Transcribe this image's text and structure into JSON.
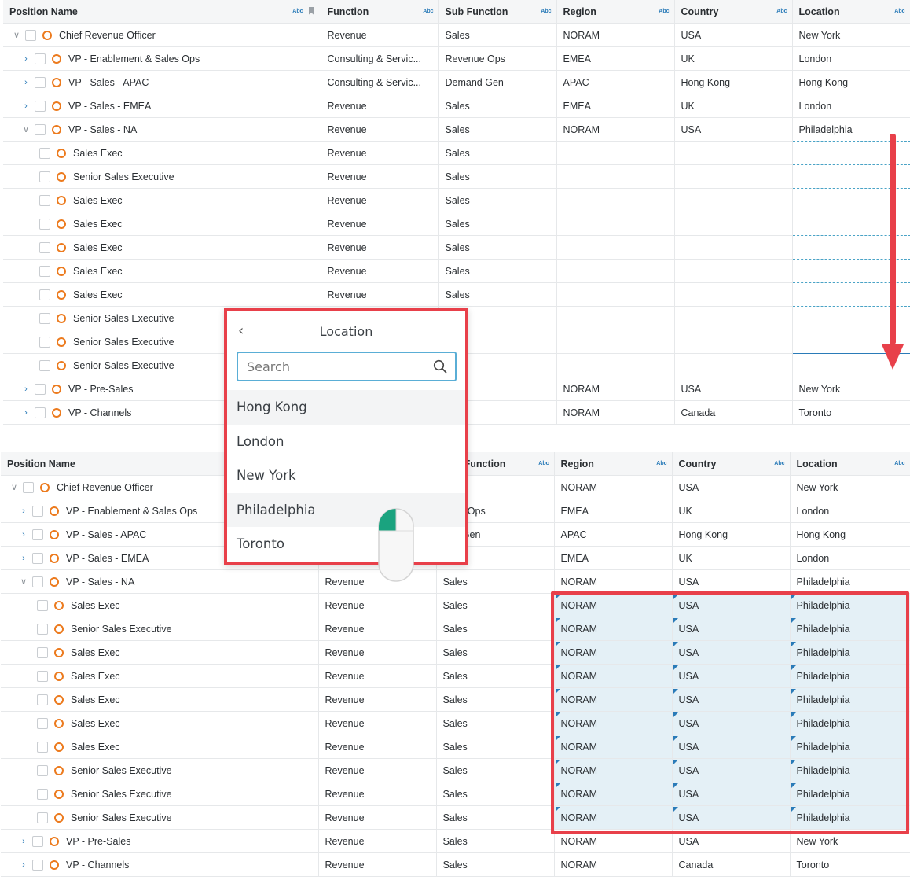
{
  "columns": [
    "Position Name",
    "Function",
    "Sub Function",
    "Region",
    "Country",
    "Location"
  ],
  "column_type_badge": "Abc",
  "top_grid": {
    "rows": [
      {
        "name": "Chief Revenue Officer",
        "level": 0,
        "expand": "open",
        "function": "Revenue",
        "sub": "Sales",
        "region": "NORAM",
        "country": "USA",
        "location": "New York"
      },
      {
        "name": "VP - Enablement & Sales Ops",
        "level": 1,
        "expand": "closed",
        "function": "Consulting & Servic...",
        "sub": "Revenue Ops",
        "region": "EMEA",
        "country": "UK",
        "location": "London"
      },
      {
        "name": "VP - Sales - APAC",
        "level": 1,
        "expand": "closed",
        "function": "Consulting & Servic...",
        "sub": "Demand Gen",
        "region": "APAC",
        "country": "Hong Kong",
        "location": "Hong Kong"
      },
      {
        "name": "VP - Sales - EMEA",
        "level": 1,
        "expand": "closed",
        "function": "Revenue",
        "sub": "Sales",
        "region": "EMEA",
        "country": "UK",
        "location": "London"
      },
      {
        "name": "VP - Sales - NA",
        "level": 1,
        "expand": "open",
        "function": "Revenue",
        "sub": "Sales",
        "region": "NORAM",
        "country": "USA",
        "location": "Philadelphia"
      },
      {
        "name": "Sales Exec",
        "level": 2,
        "expand": "none",
        "function": "Revenue",
        "sub": "Sales",
        "region": "",
        "country": "",
        "location": ""
      },
      {
        "name": "Senior Sales Executive",
        "level": 2,
        "expand": "none",
        "function": "Revenue",
        "sub": "Sales",
        "region": "",
        "country": "",
        "location": ""
      },
      {
        "name": "Sales Exec",
        "level": 2,
        "expand": "none",
        "function": "Revenue",
        "sub": "Sales",
        "region": "",
        "country": "",
        "location": ""
      },
      {
        "name": "Sales Exec",
        "level": 2,
        "expand": "none",
        "function": "Revenue",
        "sub": "Sales",
        "region": "",
        "country": "",
        "location": ""
      },
      {
        "name": "Sales Exec",
        "level": 2,
        "expand": "none",
        "function": "Revenue",
        "sub": "Sales",
        "region": "",
        "country": "",
        "location": ""
      },
      {
        "name": "Sales Exec",
        "level": 2,
        "expand": "none",
        "function": "Revenue",
        "sub": "Sales",
        "region": "",
        "country": "",
        "location": ""
      },
      {
        "name": "Sales Exec",
        "level": 2,
        "expand": "none",
        "function": "Revenue",
        "sub": "Sales",
        "region": "",
        "country": "",
        "location": ""
      },
      {
        "name": "Senior Sales Executive",
        "level": 2,
        "expand": "none",
        "function": "Revenue",
        "sub": "s",
        "region": "",
        "country": "",
        "location": ""
      },
      {
        "name": "Senior Sales Executive",
        "level": 2,
        "expand": "none",
        "function": "",
        "sub": "s",
        "region": "",
        "country": "",
        "location": ""
      },
      {
        "name": "Senior Sales Executive",
        "level": 2,
        "expand": "none",
        "function": "",
        "sub": "s",
        "region": "",
        "country": "",
        "location": ""
      },
      {
        "name": "VP - Pre-Sales",
        "level": 1,
        "expand": "closed",
        "function": "",
        "sub": "s",
        "region": "NORAM",
        "country": "USA",
        "location": "New York"
      },
      {
        "name": "VP - Channels",
        "level": 1,
        "expand": "closed",
        "function": "",
        "sub": "s",
        "region": "NORAM",
        "country": "Canada",
        "location": "Toronto"
      }
    ]
  },
  "bottom_grid": {
    "header_partial": {
      "function": "unction"
    },
    "rows": [
      {
        "name": "Chief Revenue Officer",
        "level": 0,
        "expand": "open",
        "function": "",
        "sub": "s",
        "region": "NORAM",
        "country": "USA",
        "location": "New York"
      },
      {
        "name": "VP - Enablement & Sales Ops",
        "level": 1,
        "expand": "closed",
        "function": "",
        "sub": "enue Ops",
        "region": "EMEA",
        "country": "UK",
        "location": "London"
      },
      {
        "name": "VP - Sales - APAC",
        "level": 1,
        "expand": "closed",
        "function": "",
        "sub": "and Gen",
        "region": "APAC",
        "country": "Hong Kong",
        "location": "Hong Kong"
      },
      {
        "name": "VP - Sales - EMEA",
        "level": 1,
        "expand": "closed",
        "function": "",
        "sub": "s",
        "region": "EMEA",
        "country": "UK",
        "location": "London"
      },
      {
        "name": "VP - Sales - NA",
        "level": 1,
        "expand": "open",
        "function": "Revenue",
        "sub": "Sales",
        "region": "NORAM",
        "country": "USA",
        "location": "Philadelphia"
      },
      {
        "name": "Sales Exec",
        "level": 2,
        "expand": "none",
        "function": "Revenue",
        "sub": "Sales",
        "region": "NORAM",
        "country": "USA",
        "location": "Philadelphia",
        "hl": true
      },
      {
        "name": "Senior Sales Executive",
        "level": 2,
        "expand": "none",
        "function": "Revenue",
        "sub": "Sales",
        "region": "NORAM",
        "country": "USA",
        "location": "Philadelphia",
        "hl": true
      },
      {
        "name": "Sales Exec",
        "level": 2,
        "expand": "none",
        "function": "Revenue",
        "sub": "Sales",
        "region": "NORAM",
        "country": "USA",
        "location": "Philadelphia",
        "hl": true
      },
      {
        "name": "Sales Exec",
        "level": 2,
        "expand": "none",
        "function": "Revenue",
        "sub": "Sales",
        "region": "NORAM",
        "country": "USA",
        "location": "Philadelphia",
        "hl": true
      },
      {
        "name": "Sales Exec",
        "level": 2,
        "expand": "none",
        "function": "Revenue",
        "sub": "Sales",
        "region": "NORAM",
        "country": "USA",
        "location": "Philadelphia",
        "hl": true
      },
      {
        "name": "Sales Exec",
        "level": 2,
        "expand": "none",
        "function": "Revenue",
        "sub": "Sales",
        "region": "NORAM",
        "country": "USA",
        "location": "Philadelphia",
        "hl": true
      },
      {
        "name": "Sales Exec",
        "level": 2,
        "expand": "none",
        "function": "Revenue",
        "sub": "Sales",
        "region": "NORAM",
        "country": "USA",
        "location": "Philadelphia",
        "hl": true
      },
      {
        "name": "Senior Sales Executive",
        "level": 2,
        "expand": "none",
        "function": "Revenue",
        "sub": "Sales",
        "region": "NORAM",
        "country": "USA",
        "location": "Philadelphia",
        "hl": true
      },
      {
        "name": "Senior Sales Executive",
        "level": 2,
        "expand": "none",
        "function": "Revenue",
        "sub": "Sales",
        "region": "NORAM",
        "country": "USA",
        "location": "Philadelphia",
        "hl": true
      },
      {
        "name": "Senior Sales Executive",
        "level": 2,
        "expand": "none",
        "function": "Revenue",
        "sub": "Sales",
        "region": "NORAM",
        "country": "USA",
        "location": "Philadelphia",
        "hl": true
      },
      {
        "name": "VP - Pre-Sales",
        "level": 1,
        "expand": "closed",
        "function": "Revenue",
        "sub": "Sales",
        "region": "NORAM",
        "country": "USA",
        "location": "New York"
      },
      {
        "name": "VP - Channels",
        "level": 1,
        "expand": "closed",
        "function": "Revenue",
        "sub": "Sales",
        "region": "NORAM",
        "country": "Canada",
        "location": "Toronto"
      }
    ]
  },
  "location_popup": {
    "title": "Location",
    "search_placeholder": "Search",
    "options": [
      "Hong Kong",
      "London",
      "New York",
      "Philadelphia",
      "Toronto"
    ]
  },
  "colors": {
    "accent": "#2a7bb8",
    "node_ring": "#ec7a1d",
    "callout_red": "#e8404a",
    "selection_fill": "#e4f0f6"
  },
  "icons": [
    "chevron-down-icon",
    "chevron-right-icon",
    "node-ring-icon",
    "pin-icon",
    "search-icon",
    "back-chevron-icon",
    "mouse-icon",
    "down-arrow-icon"
  ]
}
